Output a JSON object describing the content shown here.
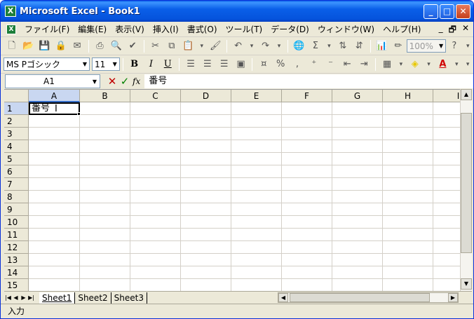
{
  "window": {
    "title": "Microsoft Excel - Book1",
    "app_icon": "X"
  },
  "window_buttons": {
    "minimize": "_",
    "maximize": "□",
    "close": "✕"
  },
  "menu": {
    "items": [
      {
        "label": "ファイル(F)"
      },
      {
        "label": "編集(E)"
      },
      {
        "label": "表示(V)"
      },
      {
        "label": "挿入(I)"
      },
      {
        "label": "書式(O)"
      },
      {
        "label": "ツール(T)"
      },
      {
        "label": "データ(D)"
      },
      {
        "label": "ウィンドウ(W)"
      },
      {
        "label": "ヘルプ(H)"
      }
    ],
    "right_min": "_",
    "right_restore": "🗗",
    "right_close": "✕"
  },
  "toolbar": {
    "zoom": "100%",
    "sum": "Σ"
  },
  "format_toolbar": {
    "font_name": "MS Pゴシック",
    "font_size": "11",
    "bold": "B",
    "italic": "I",
    "underline": "U",
    "percent": "%",
    "comma": ","
  },
  "formula_bar": {
    "name_box": "A1",
    "cancel": "✕",
    "enter": "✓",
    "fx": "fx",
    "value": "番号"
  },
  "grid": {
    "columns": [
      "A",
      "B",
      "C",
      "D",
      "E",
      "F",
      "G",
      "H",
      "I"
    ],
    "rows": [
      "1",
      "2",
      "3",
      "4",
      "5",
      "6",
      "7",
      "8",
      "9",
      "10",
      "11",
      "12",
      "13",
      "14",
      "15"
    ],
    "active_cell_value": "番号"
  },
  "sheets": [
    {
      "label": "Sheet1"
    },
    {
      "label": "Sheet2"
    },
    {
      "label": "Sheet3"
    }
  ],
  "status": {
    "mode": "入力"
  }
}
